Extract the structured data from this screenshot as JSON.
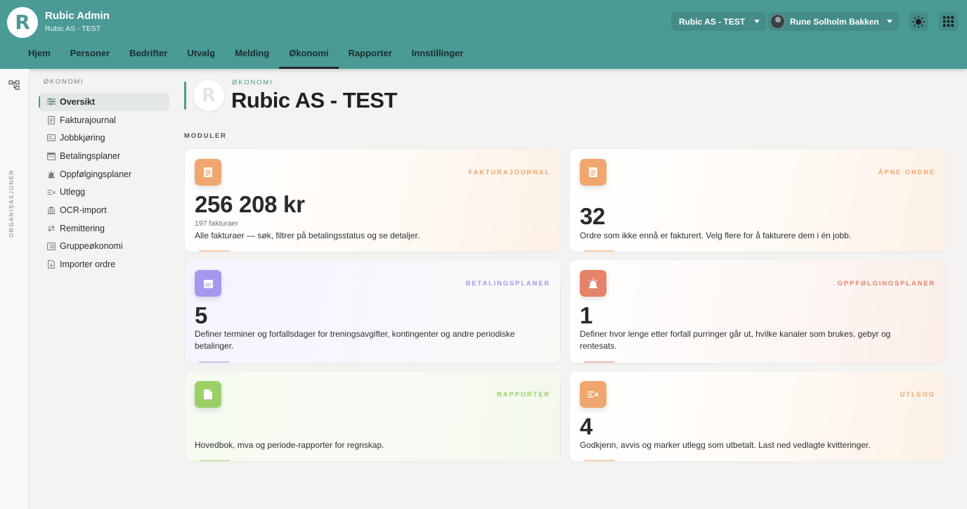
{
  "header": {
    "app_title": "Rubic Admin",
    "app_subtitle": "Rubic AS - TEST",
    "org_selector": "Rubic AS - TEST",
    "user_name": "Rune Solholm Bakken",
    "logo_icon": "rubic-logo",
    "theme_icon": "sun-icon",
    "apps_icon": "grid-icon"
  },
  "nav": {
    "items": [
      "Hjem",
      "Personer",
      "Bedrifter",
      "Utvalg",
      "Melding",
      "Økonomi",
      "Rapporter",
      "Innstillinger"
    ],
    "active": "Økonomi"
  },
  "rail": {
    "label": "ORGANISASJONER",
    "icon": "org-tree-icon"
  },
  "sidebar": {
    "heading": "ØKONOMI",
    "items": [
      {
        "label": "Oversikt",
        "icon": "sliders-icon",
        "active": true
      },
      {
        "label": "Fakturajournal",
        "icon": "receipt-icon"
      },
      {
        "label": "Jobbkjøring",
        "icon": "job-icon"
      },
      {
        "label": "Betalingsplaner",
        "icon": "calendar-icon"
      },
      {
        "label": "Oppfølgingsplaner",
        "icon": "alarm-icon"
      },
      {
        "label": "Utlegg",
        "icon": "expense-icon"
      },
      {
        "label": "OCR-import",
        "icon": "bank-icon"
      },
      {
        "label": "Remittering",
        "icon": "transfer-icon"
      },
      {
        "label": "Gruppeøkonomi",
        "icon": "wallet-icon"
      },
      {
        "label": "Importer ordre",
        "icon": "import-icon"
      }
    ]
  },
  "page": {
    "kicker": "ØKONOMI",
    "title": "Rubic AS - TEST",
    "section": "MODULER"
  },
  "cards": [
    {
      "tag": "FAKTURAJOURNAL",
      "value": "256 208 kr",
      "sub": "197 fakturaer",
      "desc": "Alle fakturaer — søk, filtrer på betalingsstatus og se detaljer.",
      "icon": "receipt-icon",
      "color": "#f0a76f"
    },
    {
      "tag": "ÅPNE ORDRE",
      "value": "32",
      "sub": "",
      "desc": "Ordre som ikke ennå er fakturert. Velg flere for å fakturere dem i én jobb.",
      "icon": "receipt-icon",
      "color": "#f0a76f"
    },
    {
      "tag": "BETALINGSPLANER",
      "value": "5",
      "sub": "",
      "desc": "Definer terminer og forfallsdager for treningsavgifter, kontingenter og andre periodiske betalinger.",
      "icon": "calendar-icon",
      "color": "#a897ee"
    },
    {
      "tag": "OPPFØLGINGSPLANER",
      "value": "1",
      "sub": "",
      "desc": "Definer hvor lenge etter forfall purringer går ut, hvilke kanaler som brukes, gebyr og rentesats.",
      "icon": "alarm-icon",
      "color": "#e4826a"
    },
    {
      "tag": "RAPPORTER",
      "value": "",
      "sub": "",
      "desc": "Hovedbok, mva og periode-rapporter for regnskap.",
      "icon": "document-icon",
      "color": "#9bd067"
    },
    {
      "tag": "UTLEGG",
      "value": "4",
      "sub": "",
      "desc": "Godkjenn, avvis og marker utlegg som utbetalt. Last ned vedlagte kvitteringer.",
      "icon": "expense-icon",
      "color": "#f0a76f"
    }
  ]
}
